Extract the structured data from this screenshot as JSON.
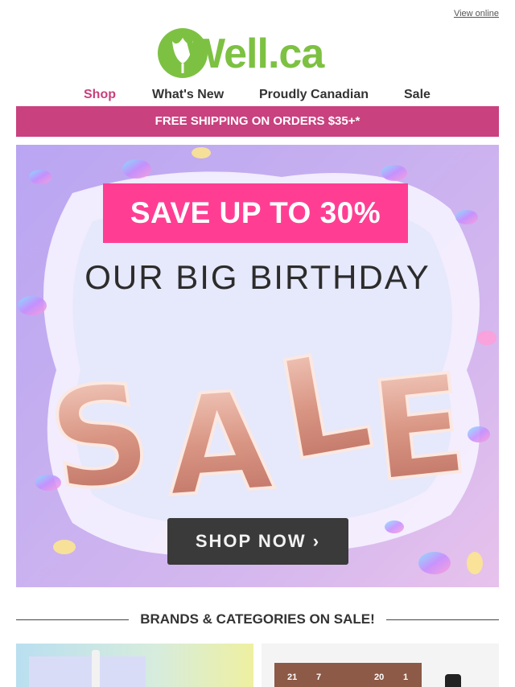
{
  "header": {
    "view_online": "View online",
    "logo_text": "Well.ca"
  },
  "nav": {
    "items": [
      {
        "label": "Shop"
      },
      {
        "label": "What's New"
      },
      {
        "label": "Proudly Canadian"
      },
      {
        "label": "Sale"
      }
    ]
  },
  "shipping_bar": {
    "text": "FREE SHIPPING ON ORDERS $35+*"
  },
  "hero": {
    "badge": "SAVE UP TO 30%",
    "headline": "OUR BIG BIRTHDAY",
    "balloon_word": "SALE",
    "cta": "SHOP NOW ›"
  },
  "section": {
    "title": "BRANDS & CATEGORIES ON SALE!"
  },
  "tiles": {
    "right": {
      "labels": [
        "21",
        "7",
        "20",
        "1"
      ]
    }
  },
  "colors": {
    "brand_green": "#7dc142",
    "brand_pink": "#c9417e",
    "hero_pink": "#ff3e93"
  }
}
